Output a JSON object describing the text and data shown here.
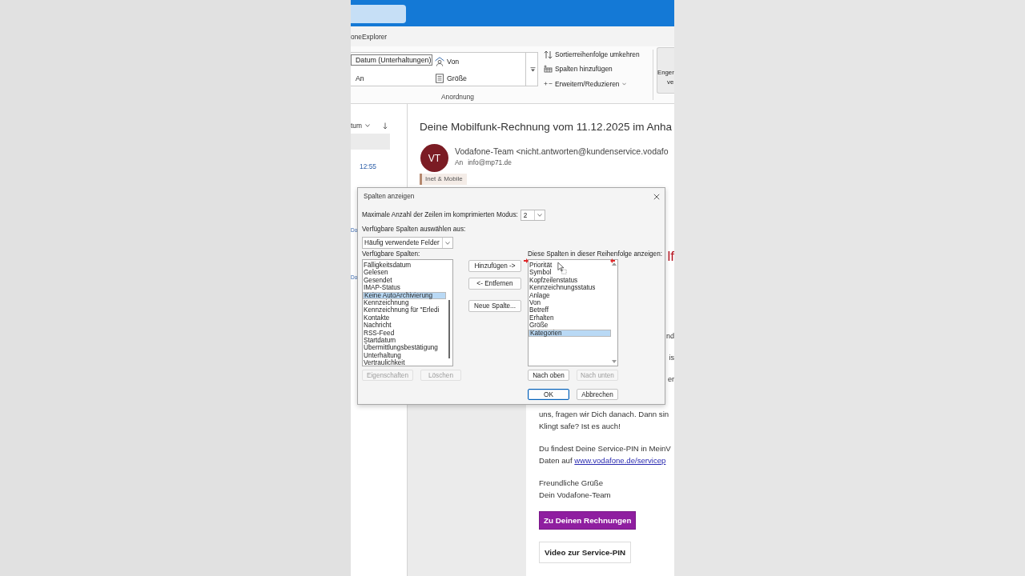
{
  "ribbon_tab": {
    "label": "oneExplorer"
  },
  "ribbon": {
    "gallery": [
      {
        "label": "Datum (Unterhaltungen)",
        "selected": true
      },
      {
        "label": "Von",
        "selected": false
      },
      {
        "label": "An",
        "selected": false
      },
      {
        "label": "Größe",
        "selected": false
      }
    ],
    "group_label": "Anordnung",
    "commands": [
      {
        "label": "Sortierreihenfolge umkehren",
        "menu": false
      },
      {
        "label": "Spalten hinzufügen",
        "menu": false
      },
      {
        "label": "Erweitern/Reduzieren",
        "menu": true
      }
    ],
    "large_button": {
      "lines": [
        "Enger",
        "ve"
      ]
    }
  },
  "message_list": {
    "sort_label": "tum",
    "time": "12:55",
    "date_fragments": [
      "Do",
      "Do"
    ]
  },
  "message": {
    "subject": "Deine Mobilfunk-Rechnung vom 11.12.2025 im Anha",
    "avatar": "VT",
    "sender": "Vodafone-Team <nicht.antworten@kundenservice.vodafo",
    "to_label": "An",
    "to": "info@mp71.de",
    "category": "Inet & Mobile",
    "body": {
      "edge_fragments": [
        {
          "text": "lf",
          "kind": "heading"
        },
        {
          "text": "nd",
          "kind": "body"
        },
        {
          "text": "is",
          "kind": "body"
        },
        {
          "text": "er",
          "kind": "body"
        }
      ],
      "paragraphs": [
        {
          "text": "uns, fragen wir Dich danach. Dann sin\nKlingt safe? Ist es auch!"
        },
        {
          "text": "Du findest Deine Service-PIN in MeinV\nDaten auf",
          "link": "www.vodafone.de/servicep"
        },
        {
          "text": "Freundliche Grüße\nDein Vodafone-Team"
        }
      ],
      "buttons": [
        {
          "label": "Zu Deinen Rechnungen",
          "kind": "primary"
        },
        {
          "label": "Video zur Service-PIN",
          "kind": "secondary"
        }
      ]
    }
  },
  "dialog": {
    "title": "Spalten anzeigen",
    "max_rows": {
      "label": "Maximale Anzahl der Zeilen im komprimierten Modus:",
      "value": "2"
    },
    "field_source": {
      "label": "Verfügbare Spalten auswählen aus:",
      "value": "Häufig verwendete Felder"
    },
    "available_label": "Verfügbare Spalten:",
    "available": [
      {
        "label": "Fälligkeitsdatum",
        "selected": false
      },
      {
        "label": "Gelesen",
        "selected": false
      },
      {
        "label": "Gesendet",
        "selected": false
      },
      {
        "label": "IMAP-Status",
        "selected": false
      },
      {
        "label": "Keine AutoArchivierung",
        "selected": true
      },
      {
        "label": "Kennzeichnung",
        "selected": false
      },
      {
        "label": "Kennzeichnung für \"Erledi",
        "selected": false
      },
      {
        "label": "Kontakte",
        "selected": false
      },
      {
        "label": "Nachricht",
        "selected": false
      },
      {
        "label": "RSS-Feed",
        "selected": false
      },
      {
        "label": "Startdatum",
        "selected": false
      },
      {
        "label": "Übermittlungsbestätigung",
        "selected": false
      },
      {
        "label": "Unterhaltung",
        "selected": false
      },
      {
        "label": "Vertraulichkeit",
        "selected": false
      }
    ],
    "available_buttons": [
      {
        "label": "Eigenschaften",
        "disabled": true
      },
      {
        "label": "Löschen",
        "disabled": true
      }
    ],
    "move_buttons": [
      {
        "label": "Hinzufügen ->",
        "disabled": false
      },
      {
        "label": "<- Entfernen",
        "disabled": false
      },
      {
        "label": "Neue Spalte...",
        "disabled": false
      }
    ],
    "shown_label": "Diese Spalten in dieser Reihenfolge anzeigen:",
    "shown": [
      {
        "label": "Priorität",
        "selected": false
      },
      {
        "label": "Symbol",
        "selected": false
      },
      {
        "label": "Kopfzeilenstatus",
        "selected": false
      },
      {
        "label": "Kennzeichnungsstatus",
        "selected": false
      },
      {
        "label": "Anlage",
        "selected": false
      },
      {
        "label": "Von",
        "selected": false
      },
      {
        "label": "Betreff",
        "selected": false
      },
      {
        "label": "Erhalten",
        "selected": false
      },
      {
        "label": "Größe",
        "selected": false
      },
      {
        "label": "Kategorien",
        "selected": true
      }
    ],
    "order_buttons": [
      {
        "label": "Nach oben",
        "disabled": false
      },
      {
        "label": "Nach unten",
        "disabled": true
      }
    ],
    "footer_buttons": [
      {
        "label": "OK",
        "default": true
      },
      {
        "label": "Abbrechen",
        "default": false
      }
    ]
  }
}
